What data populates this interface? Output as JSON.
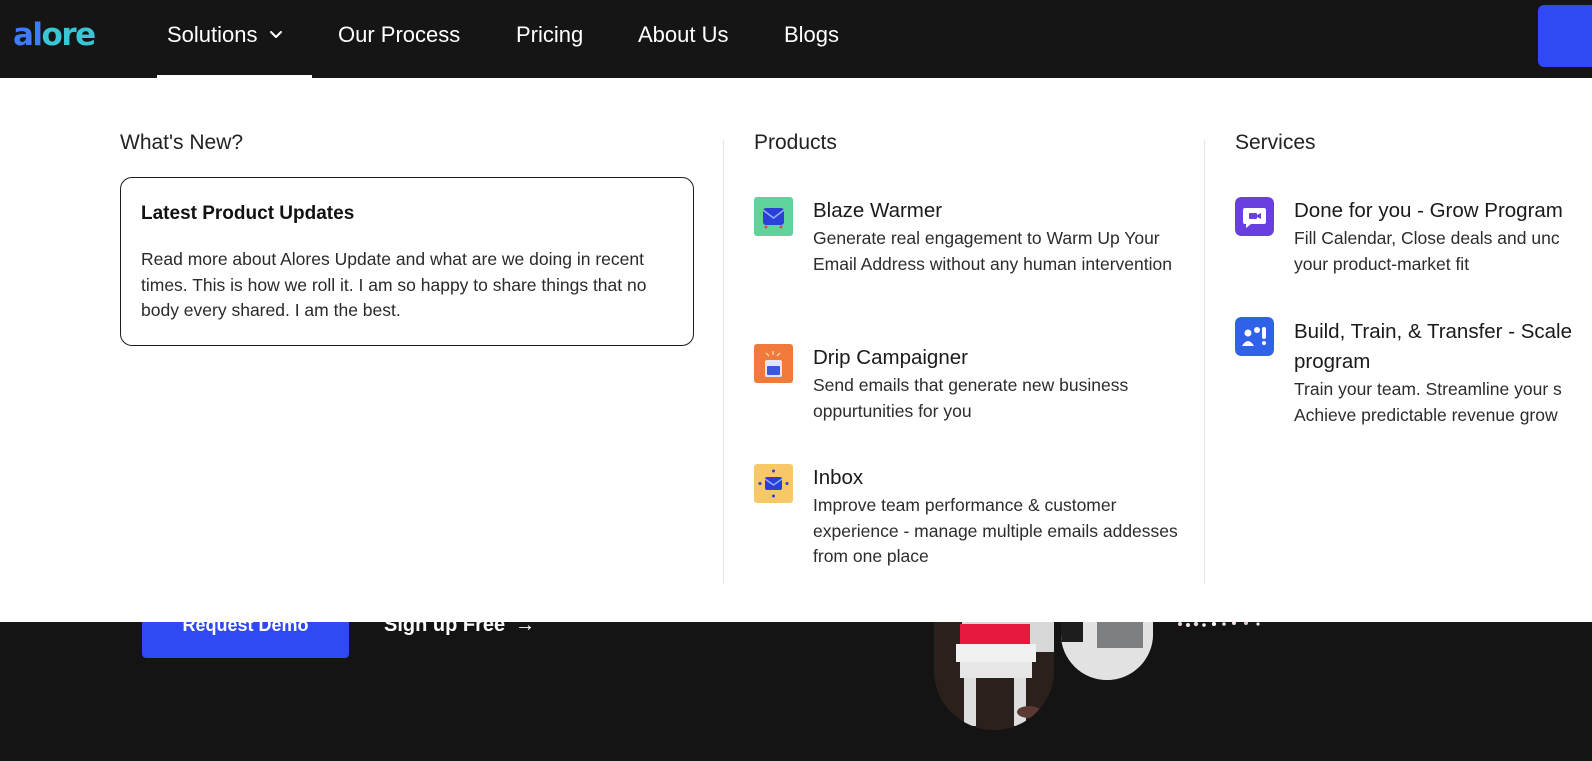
{
  "nav": {
    "logo_part1": "al",
    "logo_part2": "ore",
    "items": [
      {
        "label": "Solutions"
      },
      {
        "label": "Our Process"
      },
      {
        "label": "Pricing"
      },
      {
        "label": "About Us"
      },
      {
        "label": "Blogs"
      }
    ]
  },
  "dropdown": {
    "whats_new": {
      "title": "What's New?",
      "card_title": "Latest Product Updates",
      "card_body": "Read more about Alores Update and what are we doing in recent times. This is how we roll it. I am so happy to share things that no body every shared. I am the best."
    },
    "products": {
      "title": "Products",
      "items": [
        {
          "title": "Blaze Warmer",
          "desc": "Generate real engagement to Warm Up Your Email Address without any human intervention",
          "icon": "envelope-warm-icon"
        },
        {
          "title": "Drip Campaigner",
          "desc": "Send emails that generate new business oppurtunities for you",
          "icon": "drip-mail-icon"
        },
        {
          "title": "Inbox",
          "desc": "Improve team performance & customer experience - manage multiple emails addesses from one place",
          "icon": "inbox-icon"
        }
      ]
    },
    "services": {
      "title": "Services",
      "items": [
        {
          "title": "Done for you - Grow Program",
          "desc_line1": "Fill Calendar, Close deals and unc",
          "desc_line2": "your product-market fit",
          "icon": "video-chat-icon"
        },
        {
          "title": "Build, Train, & Transfer - Scale program",
          "desc_line1": "Train your team. Streamline your s",
          "desc_line2": "Achieve predictable revenue grow",
          "icon": "team-icon"
        }
      ]
    }
  },
  "hero": {
    "request_demo": "Request Demo",
    "signup": "Sign up Free",
    "signup_arrow": "→"
  },
  "colors": {
    "accent_blue": "#2f49f5",
    "dark_bg": "#141414",
    "logo_blue": "#3d7cff",
    "logo_teal": "#39c7d6"
  }
}
